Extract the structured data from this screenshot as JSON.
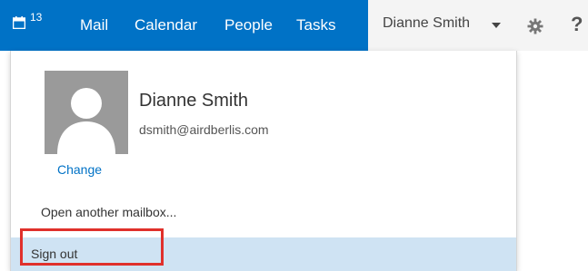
{
  "calendar": {
    "badge": "13"
  },
  "nav": {
    "items": [
      {
        "label": "Mail"
      },
      {
        "label": "Calendar"
      },
      {
        "label": "People"
      },
      {
        "label": "Tasks"
      }
    ]
  },
  "header": {
    "user_name": "Dianne Smith",
    "help_label": "?"
  },
  "profile": {
    "display_name": "Dianne Smith",
    "email": "dsmith@airdberlis.com",
    "change_label": "Change"
  },
  "menu": {
    "open_mailbox_label": "Open another mailbox...",
    "sign_out_label": "Sign out"
  },
  "colors": {
    "nav_bg": "#0072c6",
    "header_bg": "#f4f4f4",
    "hover_bg": "#cfe3f3",
    "annotation": "#e0302b"
  }
}
